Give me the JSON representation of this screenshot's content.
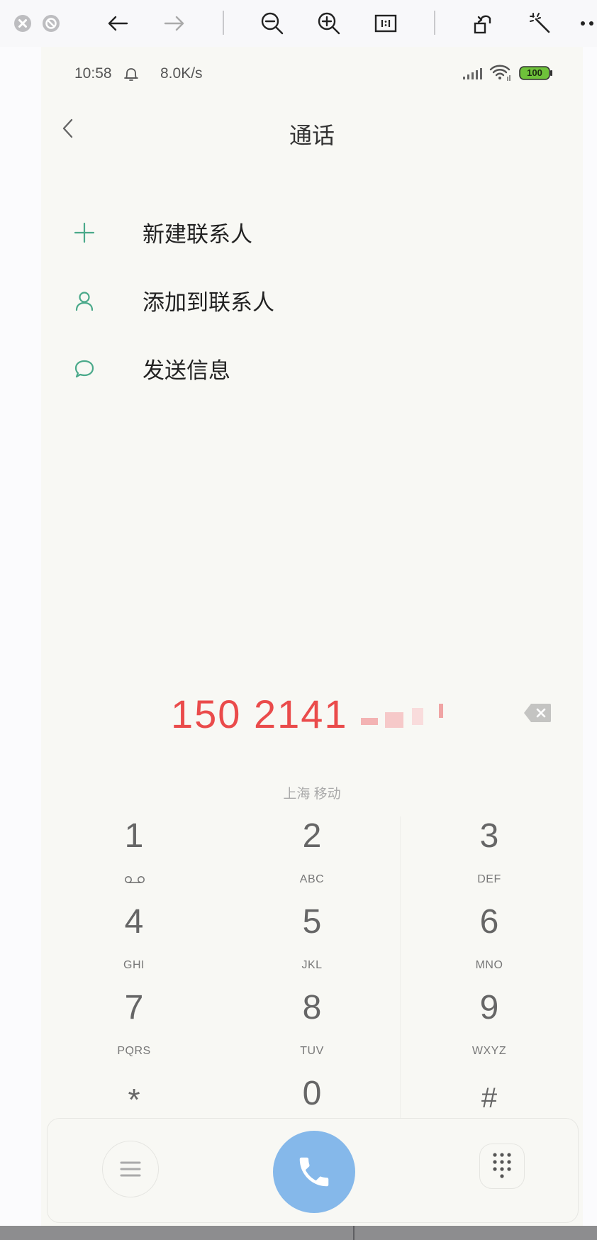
{
  "status_bar": {
    "time": "10:58",
    "speed": "8.0K/s",
    "battery": "100"
  },
  "header": {
    "title": "通话"
  },
  "actions": [
    {
      "label": "新建联系人",
      "icon": "plus-icon"
    },
    {
      "label": "添加到联系人",
      "icon": "person-icon"
    },
    {
      "label": "发送信息",
      "icon": "chat-bubble-icon"
    }
  ],
  "dialer": {
    "number": "150 2141",
    "carrier": "上海 移动"
  },
  "keys": [
    {
      "digit": "1",
      "letters": ""
    },
    {
      "digit": "2",
      "letters": "ABC"
    },
    {
      "digit": "3",
      "letters": "DEF"
    },
    {
      "digit": "4",
      "letters": "GHI"
    },
    {
      "digit": "5",
      "letters": "JKL"
    },
    {
      "digit": "6",
      "letters": "MNO"
    },
    {
      "digit": "7",
      "letters": "PQRS"
    },
    {
      "digit": "8",
      "letters": "TUV"
    },
    {
      "digit": "9",
      "letters": "WXYZ"
    },
    {
      "digit": "*",
      "letters": ""
    },
    {
      "digit": "0",
      "letters": "+"
    },
    {
      "digit": "#",
      "letters": ""
    }
  ],
  "colors": {
    "accent_green": "#4aa98a",
    "number_red": "#ea4b4b",
    "call_blue": "#85b8ea"
  }
}
